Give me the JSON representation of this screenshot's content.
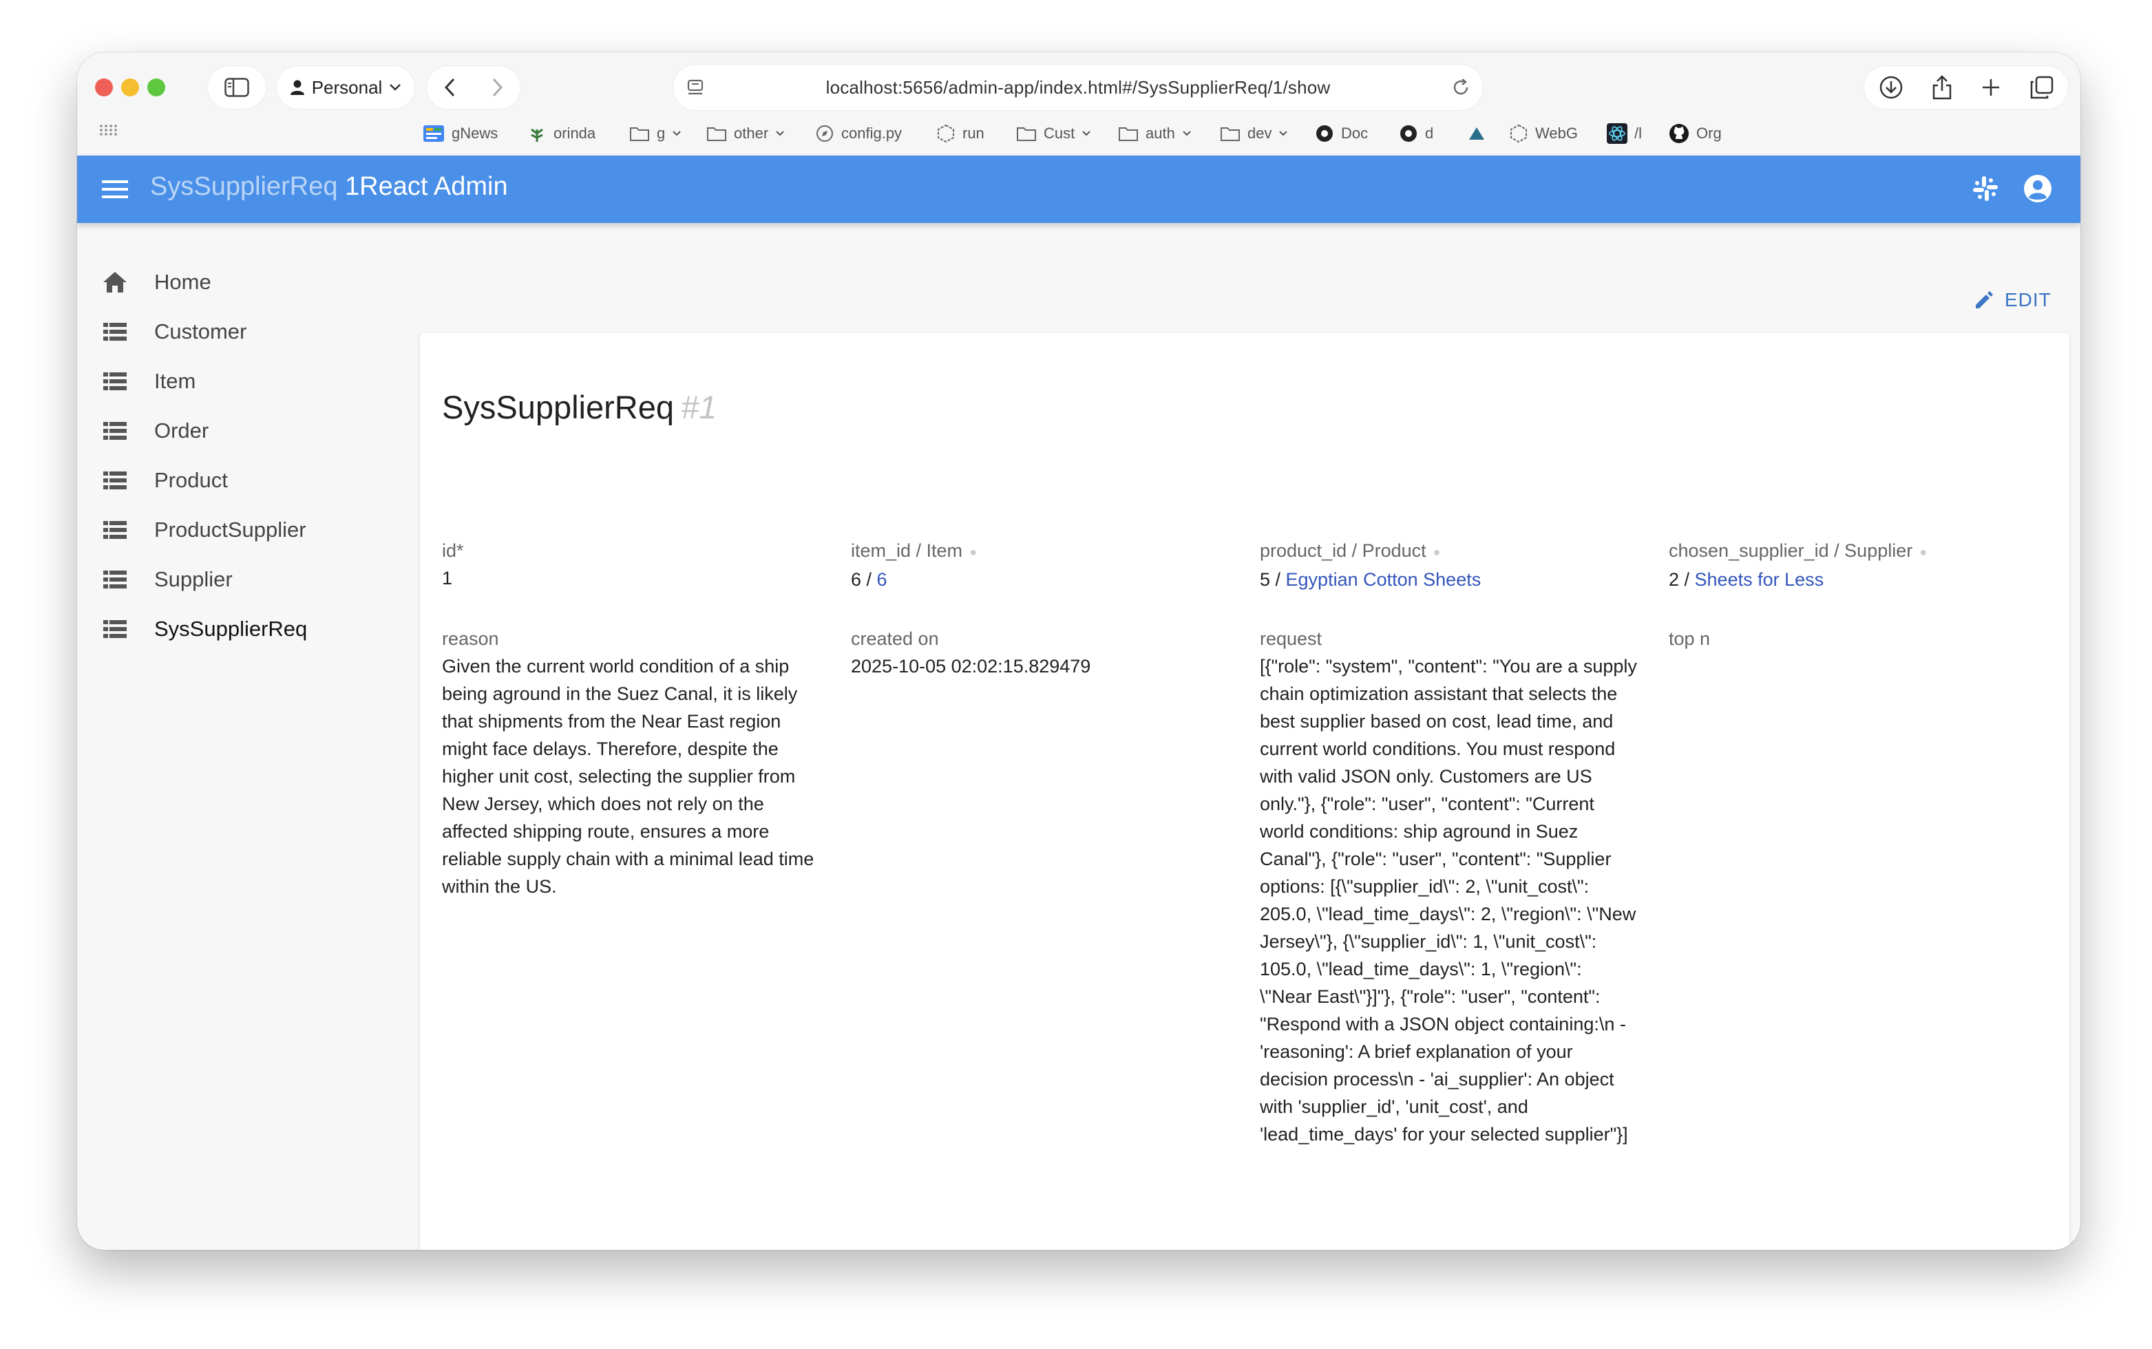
{
  "browser": {
    "profile_label": "Personal",
    "url": "localhost:5656/admin-app/index.html#/SysSupplierReq/1/show",
    "bookmarks": [
      "gNews",
      "orinda",
      "g",
      "other",
      "config.py",
      "run",
      "Cust",
      "auth",
      "dev",
      "Doc",
      "d",
      "",
      "WebG",
      "/l",
      "Org"
    ]
  },
  "appbar": {
    "title_dim": "SysSupplierReq",
    "title_main": "1React Admin"
  },
  "sidebar": {
    "items": [
      {
        "label": "Home"
      },
      {
        "label": "Customer"
      },
      {
        "label": "Item"
      },
      {
        "label": "Order"
      },
      {
        "label": "Product"
      },
      {
        "label": "ProductSupplier"
      },
      {
        "label": "Supplier"
      },
      {
        "label": "SysSupplierReq"
      }
    ]
  },
  "edit_label": "EDIT",
  "record": {
    "title": "SysSupplierReq",
    "number": "#1",
    "fields": {
      "id": {
        "label": "id*",
        "value": "1"
      },
      "item": {
        "label": "item_id / Item",
        "value": "6 / ",
        "link": "6"
      },
      "product": {
        "label": "product_id / Product",
        "value": "5 / ",
        "link": "Egyptian Cotton Sheets"
      },
      "supplier": {
        "label": "chosen_supplier_id / Supplier",
        "value": "2 / ",
        "link": "Sheets for Less"
      },
      "reason": {
        "label": "reason",
        "value": "Given the current world condition of a ship being aground in the Suez Canal, it is likely that shipments from the Near East region might face delays. Therefore, despite the higher unit cost, selecting the supplier from New Jersey, which does not rely on the affected shipping route, ensures a more reliable supply chain with a minimal lead time within the US."
      },
      "created_on": {
        "label": "created on",
        "value": "2025-10-05 02:02:15.829479"
      },
      "request": {
        "label": "request",
        "value": "[{\"role\": \"system\", \"content\": \"You are a supply chain optimization assistant that selects the best supplier based on cost, lead time, and current world conditions. You must respond with valid JSON only. Customers are US only.\"}, {\"role\": \"user\", \"content\": \"Current world conditions: ship aground in Suez Canal\"}, {\"role\": \"user\", \"content\": \"Supplier options: [{\\\"supplier_id\\\": 2, \\\"unit_cost\\\": 205.0, \\\"lead_time_days\\\": 2, \\\"region\\\": \\\"New Jersey\\\"}, {\\\"supplier_id\\\": 1, \\\"unit_cost\\\": 105.0, \\\"lead_time_days\\\": 1, \\\"region\\\": \\\"Near East\\\"}]\"}, {\"role\": \"user\", \"content\": \"Respond with a JSON object containing:\\n - 'reasoning': A brief explanation of your decision process\\n - 'ai_supplier': An object with 'supplier_id', 'unit_cost', and 'lead_time_days' for your selected supplier\"}]"
      },
      "top_n": {
        "label": "top n",
        "value": ""
      }
    }
  },
  "colors": {
    "appbar": "#4a90e8",
    "link": "#3355bb",
    "edit": "#3b75c4"
  }
}
